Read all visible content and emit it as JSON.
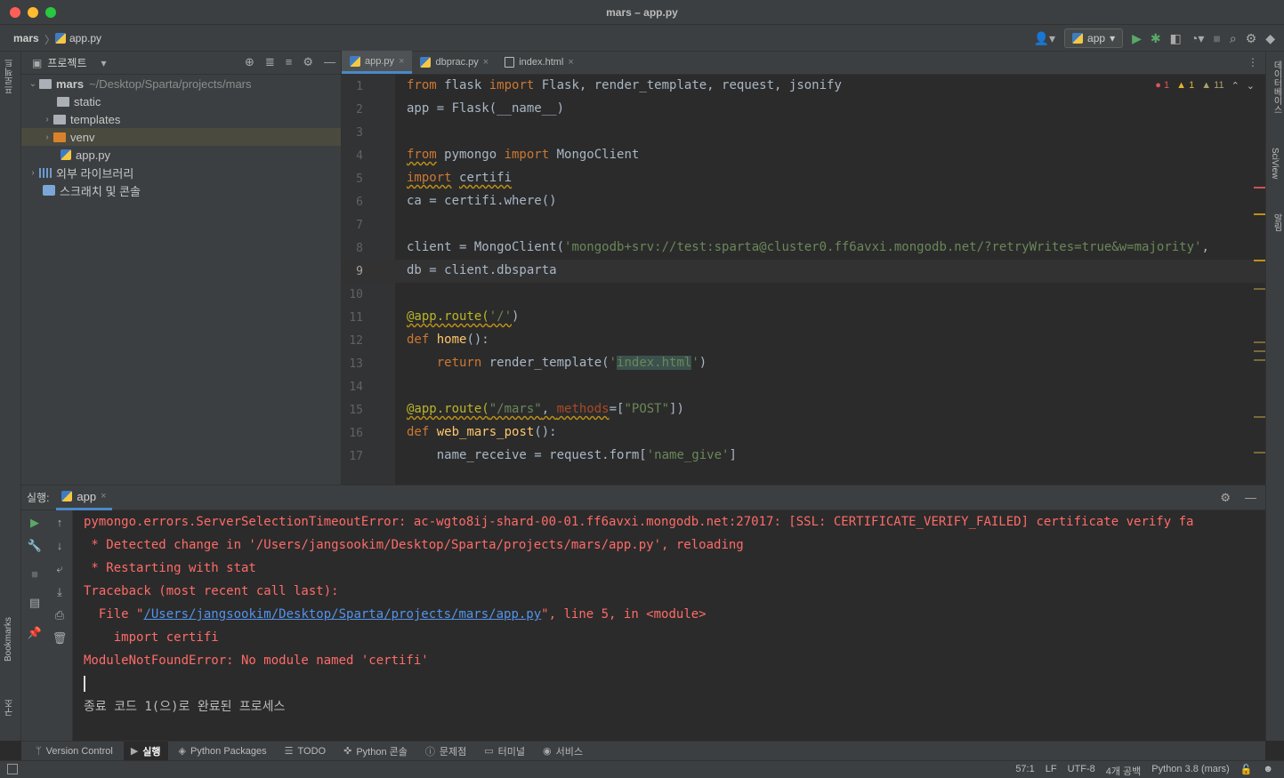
{
  "window": {
    "title": "mars – app.py"
  },
  "navbar": {
    "project": "mars",
    "separator": "〉",
    "file": "app.py",
    "run_config": "app"
  },
  "left_stripe": {
    "project_label": "프로젝트",
    "bookmarks_label": "Bookmarks",
    "structure_label": "구조"
  },
  "right_stripe": {
    "database_label": "데이터베이스",
    "sciview_label": "SciView",
    "notifications_label": "알림"
  },
  "project_panel": {
    "title": "프로젝트",
    "root_name": "mars",
    "root_path": "~/Desktop/Sparta/projects/mars",
    "items": [
      {
        "label": "static"
      },
      {
        "label": "templates"
      },
      {
        "label": "venv"
      },
      {
        "label": "app.py"
      }
    ],
    "external_libs": "외부 라이브러리",
    "scratches": "스크래치 및 콘솔"
  },
  "editor": {
    "tabs": [
      {
        "label": "app.py"
      },
      {
        "label": "dbprac.py"
      },
      {
        "label": "index.html"
      }
    ],
    "inspections": {
      "errors": "1",
      "warnings": "1",
      "weak": "11"
    },
    "line_numbers": [
      "1",
      "2",
      "3",
      "4",
      "5",
      "6",
      "7",
      "8",
      "9",
      "10",
      "11",
      "12",
      "13",
      "14",
      "15",
      "16",
      "17"
    ],
    "code": {
      "l1": {
        "from": "from",
        "mod": " flask ",
        "imp": "import",
        "rest": " Flask, render_template, request, jsonify"
      },
      "l2": "app = Flask(__name__)",
      "l4": {
        "from": "from",
        "mod": " pymongo ",
        "imp": "import",
        "rest": " MongoClient"
      },
      "l5": {
        "imp": "import",
        "mod": "certifi"
      },
      "l6": "ca = certifi.where()",
      "l8": {
        "pre": "client = MongoClient(",
        "str": "'mongodb+srv://test:sparta@cluster0.ff6avxi.mongodb.net/?retryWrites=true&w=majority'",
        "post": ","
      },
      "l9": "db = client.dbsparta",
      "l11": {
        "dec": "@app.route(",
        "str": "'/'",
        "post": ")"
      },
      "l12": {
        "kw": "def",
        "fn": "home",
        "post": "():"
      },
      "l13": {
        "kw": "return",
        "mid": " render_template(",
        "q1": "'",
        "hl": "index.html",
        "q2": "'",
        "post": ")"
      },
      "l15": {
        "dec": "@app.route(",
        "str": "\"/mars\"",
        "mid": ", ",
        "kwarg": "methods",
        "eq": "=[",
        "str2": "\"POST\"",
        "post": "])"
      },
      "l16": {
        "kw": "def",
        "fn": "web_mars_post",
        "post": "():"
      },
      "l17": {
        "pre": "name_receive = request.form[",
        "str": "'name_give'",
        "post": "]"
      }
    }
  },
  "run_panel": {
    "label": "실행:",
    "tab": "app",
    "console": {
      "line1": "pymongo.errors.ServerSelectionTimeoutError: ac-wgto8ij-shard-00-01.ff6avxi.mongodb.net:27017: [SSL: CERTIFICATE_VERIFY_FAILED] certificate verify fa",
      "line2": " * Detected change in '/Users/jangsookim/Desktop/Sparta/projects/mars/app.py', reloading",
      "line3": " * Restarting with stat",
      "line4": "Traceback (most recent call last):",
      "line5_pre": "  File \"",
      "line5_link": "/Users/jangsookim/Desktop/Sparta/projects/mars/app.py",
      "line5_post": "\", line 5, in <module>",
      "line6": "    import certifi",
      "line7": "ModuleNotFoundError: No module named 'certifi'",
      "line9": "종료 코드 1(으)로 완료된 프로세스"
    }
  },
  "bottom_tabs": [
    {
      "label": "Version Control"
    },
    {
      "label": "실행"
    },
    {
      "label": "Python Packages"
    },
    {
      "label": "TODO"
    },
    {
      "label": "Python 콘솔"
    },
    {
      "label": "문제점"
    },
    {
      "label": "터미널"
    },
    {
      "label": "서비스"
    }
  ],
  "status": {
    "position": "57:1",
    "line_sep": "LF",
    "encoding": "UTF-8",
    "indent": "4개 공백",
    "interpreter": "Python 3.8 (mars)"
  },
  "colors": {
    "accent": "#4a88c7",
    "error_text": "#ff6b68",
    "link": "#5394ec"
  }
}
